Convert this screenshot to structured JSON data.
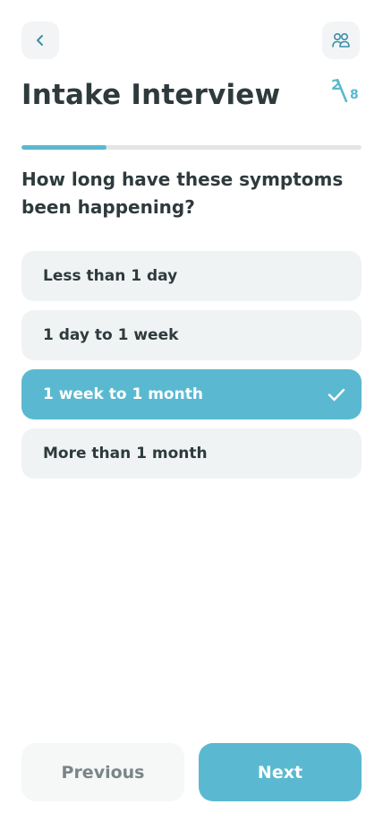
{
  "header": {
    "title": "Intake Interview",
    "step_current": "2",
    "step_total": "8",
    "back_icon": "chevron-left-icon",
    "users_icon": "users-icon"
  },
  "progress": {
    "fraction": 0.25
  },
  "question": "How long have these symptoms been happening?",
  "options": [
    {
      "label": "Less than 1 day",
      "selected": false
    },
    {
      "label": "1 day to 1 week",
      "selected": false
    },
    {
      "label": "1 week to 1 month",
      "selected": true
    },
    {
      "label": "More than 1 month",
      "selected": false
    }
  ],
  "footer": {
    "previous_label": "Previous",
    "next_label": "Next"
  },
  "colors": {
    "accent": "#5ab9d0",
    "text": "#2e3a3c",
    "option_bg": "#f0f3f4",
    "track": "#e3e5e6"
  }
}
